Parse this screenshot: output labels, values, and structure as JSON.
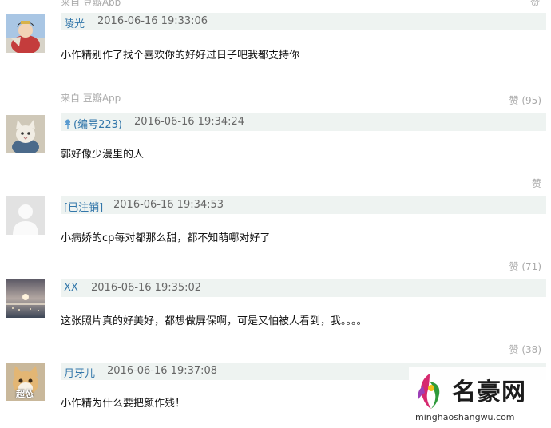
{
  "top_partial": {
    "source": "来自 豆瓣App",
    "like_label": "赞"
  },
  "comments": [
    {
      "name": "陵光",
      "time": "2016-06-16 19:33:06",
      "text": "小作精别作了找个喜欢你的好好过日子吧我都支持你",
      "source": "来自 豆瓣App",
      "likes": "赞 (95)"
    },
    {
      "name": "(编号223)",
      "time": "2016-06-16 19:34:24",
      "text": "郭好像少漫里的人",
      "source": "",
      "likes": "赞"
    },
    {
      "name": "[已注销]",
      "time": "2016-06-16 19:34:53",
      "text": "小病娇的cp每对都那么甜，都不知萌哪对好了",
      "source": "",
      "likes": "赞 (71)"
    },
    {
      "name": "XX",
      "time": "2016-06-16 19:35:02",
      "text": "这张照片真的好美好，都想做屏保啊，可是又怕被人看到，我。。。。",
      "source": "",
      "likes": "赞 (38)"
    },
    {
      "name": "月牙儿",
      "time": "2016-06-16 19:37:08",
      "text": "小作精为什么要把颜作残！",
      "source": "",
      "likes": ""
    }
  ],
  "avatar5_label": "超怂",
  "watermark": {
    "name": "名豪网",
    "url": "minghaoshangwu.com"
  },
  "colors": {
    "name_link": "#3377aa",
    "header_bg": "#eef3f1",
    "muted": "#aaaaaa"
  }
}
